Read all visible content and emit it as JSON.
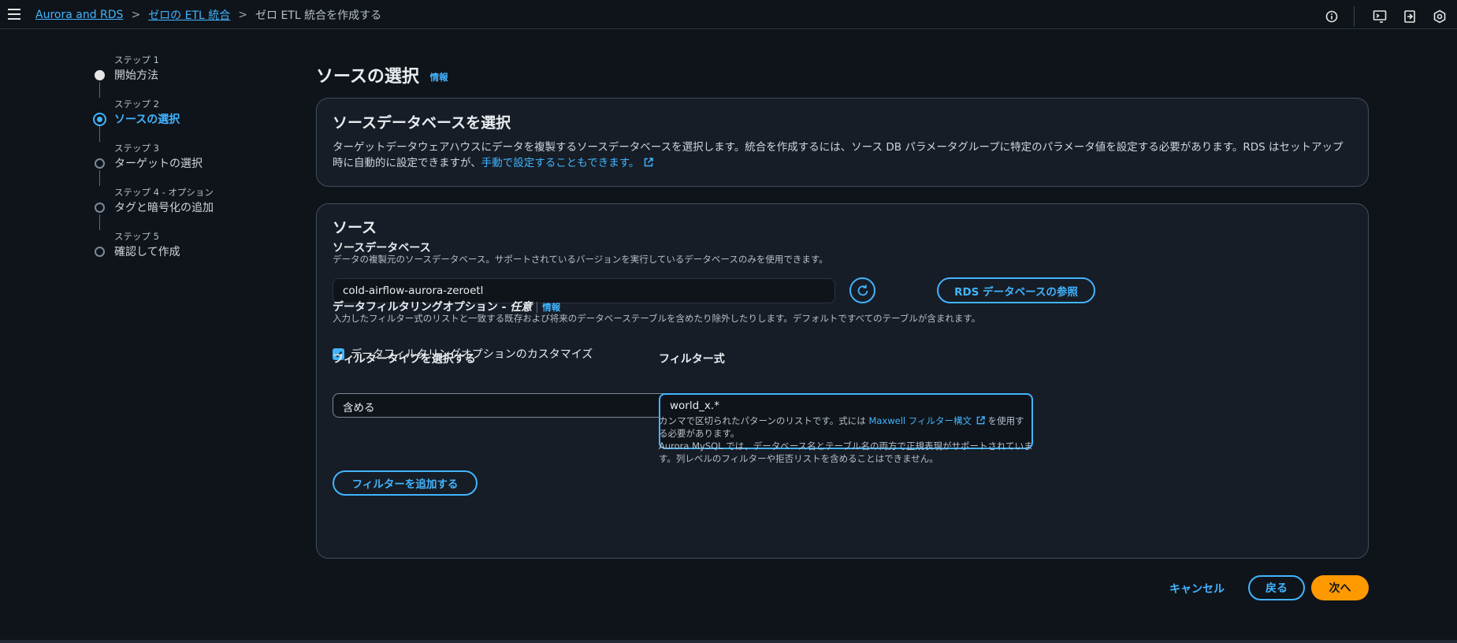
{
  "breadcrumb": {
    "item1": "Aurora and RDS",
    "item2": "ゼロの ETL 統合",
    "current": "ゼロ ETL 統合を作成する",
    "separator": ">"
  },
  "top_icons": [
    "info-icon",
    "cloudshell-icon",
    "notifications-icon",
    "settings-icon"
  ],
  "steps": [
    {
      "num": "ステップ 1",
      "name": "開始方法"
    },
    {
      "num": "ステップ 2",
      "name": "ソースの選択"
    },
    {
      "num": "ステップ 3",
      "name": "ターゲットの選択"
    },
    {
      "num": "ステップ 4 - オプション",
      "name": "タグと暗号化の追加"
    },
    {
      "num": "ステップ 5",
      "name": "確認して作成"
    }
  ],
  "page": {
    "title": "ソースの選択",
    "info": "情報"
  },
  "card1": {
    "title": "ソースデータベースを選択",
    "text": "ターゲットデータウェアハウスにデータを複製するソースデータベースを選択します。統合を作成するには、ソース DB パラメータグループに特定のパラメータ値を設定する必要があります。RDS はセットアップ時に自動的に設定できますが、",
    "link": "手動で設定することもできます。"
  },
  "card2": {
    "title": "ソース",
    "source_db_label": "ソースデータベース",
    "source_db_desc": "データの複製元のソースデータベース。サポートされているバージョンを実行しているデータベースのみを使用できます。",
    "source_db_value": "cold-airflow-aurora-zeroetl",
    "browse_button": "RDS データベースの参照",
    "filter_label": "データフィルタリングオプション - ",
    "filter_label_optional": "任意",
    "filter_info": "情報",
    "filter_desc": "入力したフィルター式のリストと一致する既存および将来のデータベーステーブルを含めたり除外したりします。デフォルトですべてのテーブルが含まれます。",
    "customize_label": "データフィルタリングオプションのカスタマイズ",
    "customize_checked": true,
    "filter_type_label": "フィルタータイプを選択する",
    "filter_type_value": "含める",
    "filter_expr_label": "フィルター式",
    "filter_expr_value": "world_x.*",
    "hint1_pre": "カンマで区切られたパターンのリストです。式には ",
    "hint1_link": "Maxwell フィルター構文",
    "hint1_post": " を使用する必要があります。",
    "hint2": "Aurora MySQL では、データベース名とテーブル名の両方で正規表現がサポートされています。列レベルのフィルターや拒否リストを含めることはできません。",
    "add_filter_button": "フィルターを追加する"
  },
  "footer": {
    "cancel": "キャンセル",
    "back": "戻る",
    "next": "次へ"
  },
  "colors": {
    "background": "#0f141a",
    "accent": "#42b4ff",
    "primary_button": "#ff9900"
  }
}
